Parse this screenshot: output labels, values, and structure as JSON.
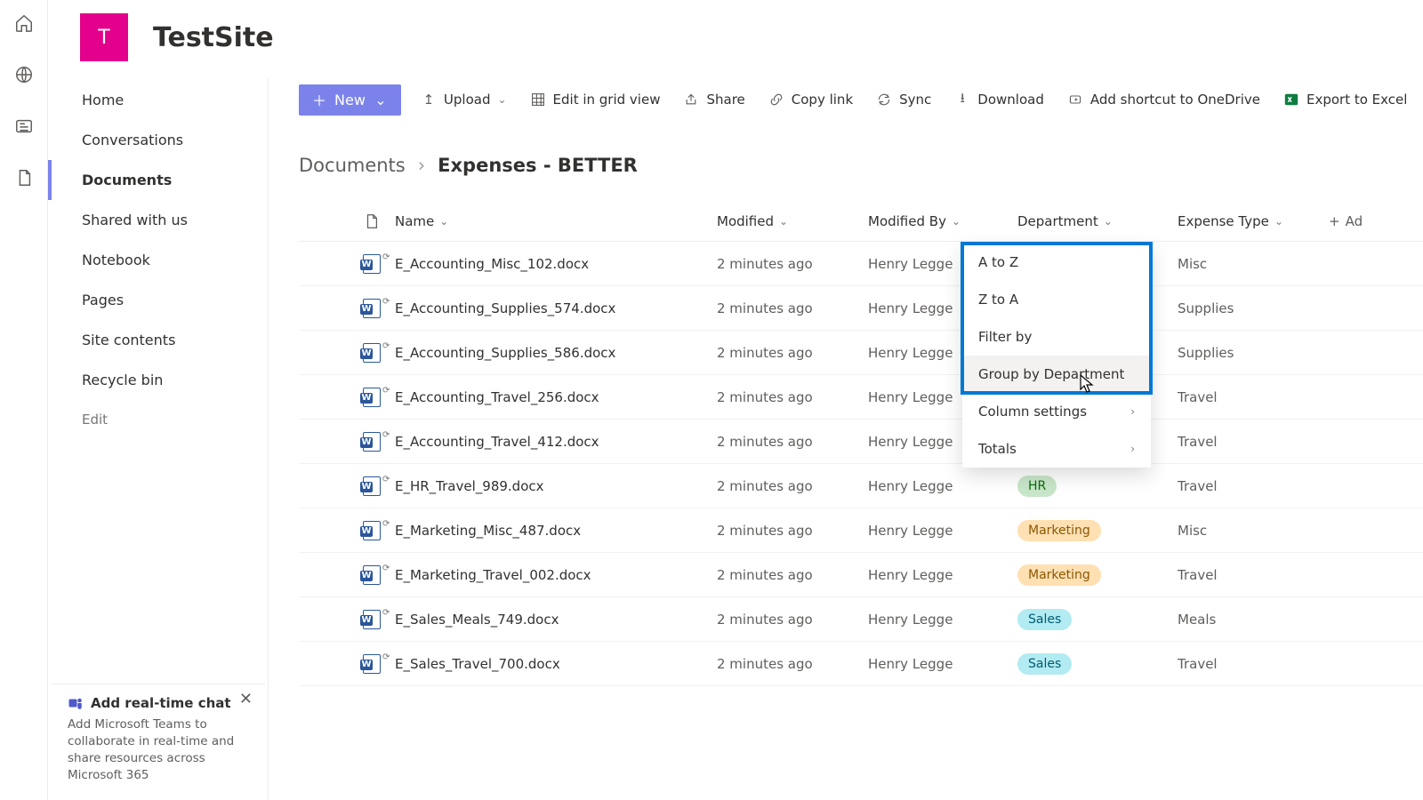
{
  "site": {
    "logo_letter": "T",
    "title": "TestSite"
  },
  "leftnav": {
    "items": [
      "Home",
      "Conversations",
      "Documents",
      "Shared with us",
      "Notebook",
      "Pages",
      "Site contents",
      "Recycle bin"
    ],
    "selected_index": 2,
    "edit_label": "Edit"
  },
  "teams_promo": {
    "title": "Add real-time chat",
    "desc": "Add Microsoft Teams to collaborate in real-time and share resources across Microsoft 365"
  },
  "toolbar": {
    "new": "New",
    "upload": "Upload",
    "edit_grid": "Edit in grid view",
    "share": "Share",
    "copy_link": "Copy link",
    "sync": "Sync",
    "download": "Download",
    "shortcut": "Add shortcut to OneDrive",
    "export": "Export to Excel",
    "add_col": "Ad"
  },
  "breadcrumb": {
    "root": "Documents",
    "leaf": "Expenses - BETTER"
  },
  "columns": {
    "name": "Name",
    "modified": "Modified",
    "modified_by": "Modified By",
    "department": "Department",
    "expense_type": "Expense Type",
    "add": "Ad"
  },
  "rows": [
    {
      "name": "E_Accounting_Misc_102.docx",
      "modified": "2 minutes ago",
      "by": "Henry Legge",
      "dept": "",
      "exp": "Misc"
    },
    {
      "name": "E_Accounting_Supplies_574.docx",
      "modified": "2 minutes ago",
      "by": "Henry Legge",
      "dept": "",
      "exp": "Supplies"
    },
    {
      "name": "E_Accounting_Supplies_586.docx",
      "modified": "2 minutes ago",
      "by": "Henry Legge",
      "dept": "",
      "exp": "Supplies"
    },
    {
      "name": "E_Accounting_Travel_256.docx",
      "modified": "2 minutes ago",
      "by": "Henry Legge",
      "dept": "",
      "exp": "Travel"
    },
    {
      "name": "E_Accounting_Travel_412.docx",
      "modified": "2 minutes ago",
      "by": "Henry Legge",
      "dept": "",
      "exp": "Travel"
    },
    {
      "name": "E_HR_Travel_989.docx",
      "modified": "2 minutes ago",
      "by": "Henry Legge",
      "dept": "HR",
      "exp": "Travel"
    },
    {
      "name": "E_Marketing_Misc_487.docx",
      "modified": "2 minutes ago",
      "by": "Henry Legge",
      "dept": "Marketing",
      "exp": "Misc"
    },
    {
      "name": "E_Marketing_Travel_002.docx",
      "modified": "2 minutes ago",
      "by": "Henry Legge",
      "dept": "Marketing",
      "exp": "Travel"
    },
    {
      "name": "E_Sales_Meals_749.docx",
      "modified": "2 minutes ago",
      "by": "Henry Legge",
      "dept": "Sales",
      "exp": "Meals"
    },
    {
      "name": "E_Sales_Travel_700.docx",
      "modified": "2 minutes ago",
      "by": "Henry Legge",
      "dept": "Sales",
      "exp": "Travel"
    }
  ],
  "column_menu": {
    "a_to_z": "A to Z",
    "z_to_a": "Z to A",
    "filter": "Filter by",
    "group": "Group by Department",
    "settings": "Column settings",
    "totals": "Totals"
  }
}
